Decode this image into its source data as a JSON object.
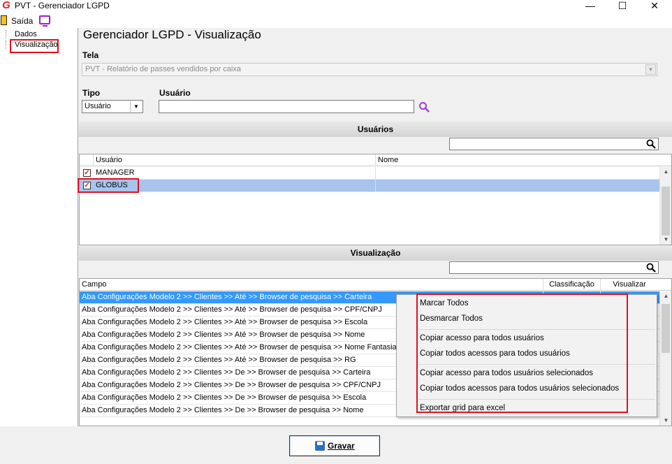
{
  "window": {
    "title": "PVT - Gerenciador LGPD",
    "minimize": "—",
    "maximize": "☐",
    "close": "✕"
  },
  "menu": {
    "exit_label": "Saída"
  },
  "tree": {
    "items": [
      {
        "label": "Dados"
      },
      {
        "label": "Visualização"
      }
    ]
  },
  "page_title": "Gerenciador LGPD - Visualização",
  "tela": {
    "label": "Tela",
    "value": "PVT - Relatório de passes vendidos por caixa"
  },
  "tipo": {
    "label": "Tipo",
    "value": "Usuário"
  },
  "usuario": {
    "label": "Usuário",
    "value": ""
  },
  "users_section": {
    "title": "Usuários",
    "columns": [
      "Usuário",
      "Nome"
    ],
    "rows": [
      {
        "usuario": "MANAGER",
        "nome": "",
        "checked": true
      },
      {
        "usuario": "GLOBUS",
        "nome": "",
        "checked": true,
        "selected": true
      }
    ]
  },
  "vis_section": {
    "title": "Visualização",
    "columns": [
      "Campo",
      "Classificação",
      "Visualizar"
    ],
    "rows": [
      "Aba Configurações Modelo 2 >> Clientes >> Até >> Browser de pesquisa >> Carteira",
      "Aba Configurações Modelo 2 >> Clientes >> Até >> Browser de pesquisa >> CPF/CNPJ",
      "Aba Configurações Modelo 2 >> Clientes >> Até >> Browser de pesquisa >> Escola",
      "Aba Configurações Modelo 2 >> Clientes >> Até >> Browser de pesquisa >> Nome",
      "Aba Configurações Modelo 2 >> Clientes >> Até >> Browser de pesquisa >> Nome Fantasia",
      "Aba Configurações Modelo 2 >> Clientes >> Até >> Browser de pesquisa >> RG",
      "Aba Configurações Modelo 2 >> Clientes >> De >> Browser de pesquisa >> Carteira",
      "Aba Configurações Modelo 2 >> Clientes >> De >> Browser de pesquisa >> CPF/CNPJ",
      "Aba Configurações Modelo 2 >> Clientes >> De >> Browser de pesquisa >> Escola",
      "Aba Configurações Modelo 2 >> Clientes >> De >> Browser de pesquisa >> Nome"
    ]
  },
  "context_menu": {
    "items": [
      "Marcar Todos",
      "Desmarcar Todos",
      "Copiar acesso para todos usuários",
      "Copiar todos acessos para todos usuários",
      "Copiar acesso para todos usuários selecionados",
      "Copiar todos acessos para todos usuários selecionados",
      "Exportar grid para excel"
    ]
  },
  "buttons": {
    "save_label": "Gravar"
  },
  "colors": {
    "selection": "#a8c4ec",
    "row_selected_dark": "#3399ff",
    "highlight_border": "#e01020"
  }
}
